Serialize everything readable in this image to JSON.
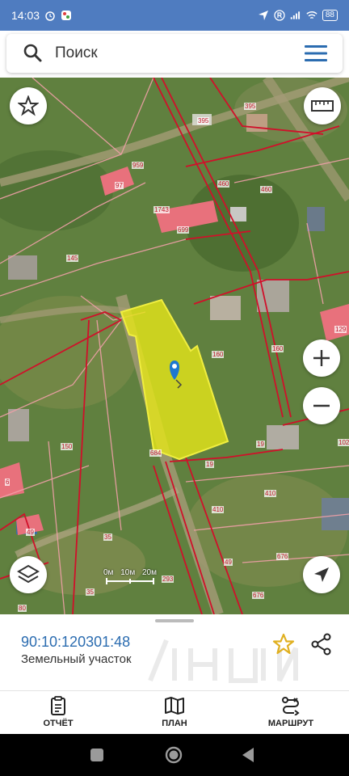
{
  "status_bar": {
    "time": "14:03",
    "battery": "88"
  },
  "search": {
    "placeholder": "Поиск"
  },
  "map": {
    "plot_labels": [
      {
        "text": "395"
      },
      {
        "text": "395"
      },
      {
        "text": "959"
      },
      {
        "text": "97"
      },
      {
        "text": "460"
      },
      {
        "text": "460"
      },
      {
        "text": "1743"
      },
      {
        "text": "699"
      },
      {
        "text": "145"
      },
      {
        "text": "129"
      },
      {
        "text": "160"
      },
      {
        "text": "160"
      },
      {
        "text": "19"
      },
      {
        "text": "19"
      },
      {
        "text": "102"
      },
      {
        "text": "150"
      },
      {
        "text": "684"
      },
      {
        "text": "410"
      },
      {
        "text": "410"
      },
      {
        "text": "676"
      },
      {
        "text": "676"
      },
      {
        "text": "35"
      },
      {
        "text": "35"
      },
      {
        "text": "293"
      },
      {
        "text": "80"
      },
      {
        "text": "49"
      },
      {
        "text": "49"
      },
      {
        "text": "6"
      }
    ],
    "scale": {
      "labels": [
        "0м",
        "10м",
        "20м"
      ]
    },
    "highlight_color": "#e6e619",
    "boundary_color": "#d0102a"
  },
  "sheet": {
    "cadastral_number": "90:10:120301:48",
    "object_type": "Земельный участок"
  },
  "bottom_nav": [
    {
      "label": "ОТЧЁТ",
      "icon": "clipboard-icon"
    },
    {
      "label": "ПЛАН",
      "icon": "map-icon"
    },
    {
      "label": "МАРШРУТ",
      "icon": "route-icon"
    }
  ],
  "colors": {
    "accent": "#2b6cb0",
    "status_bar": "#4f7cc0",
    "star": "#e0b020"
  }
}
